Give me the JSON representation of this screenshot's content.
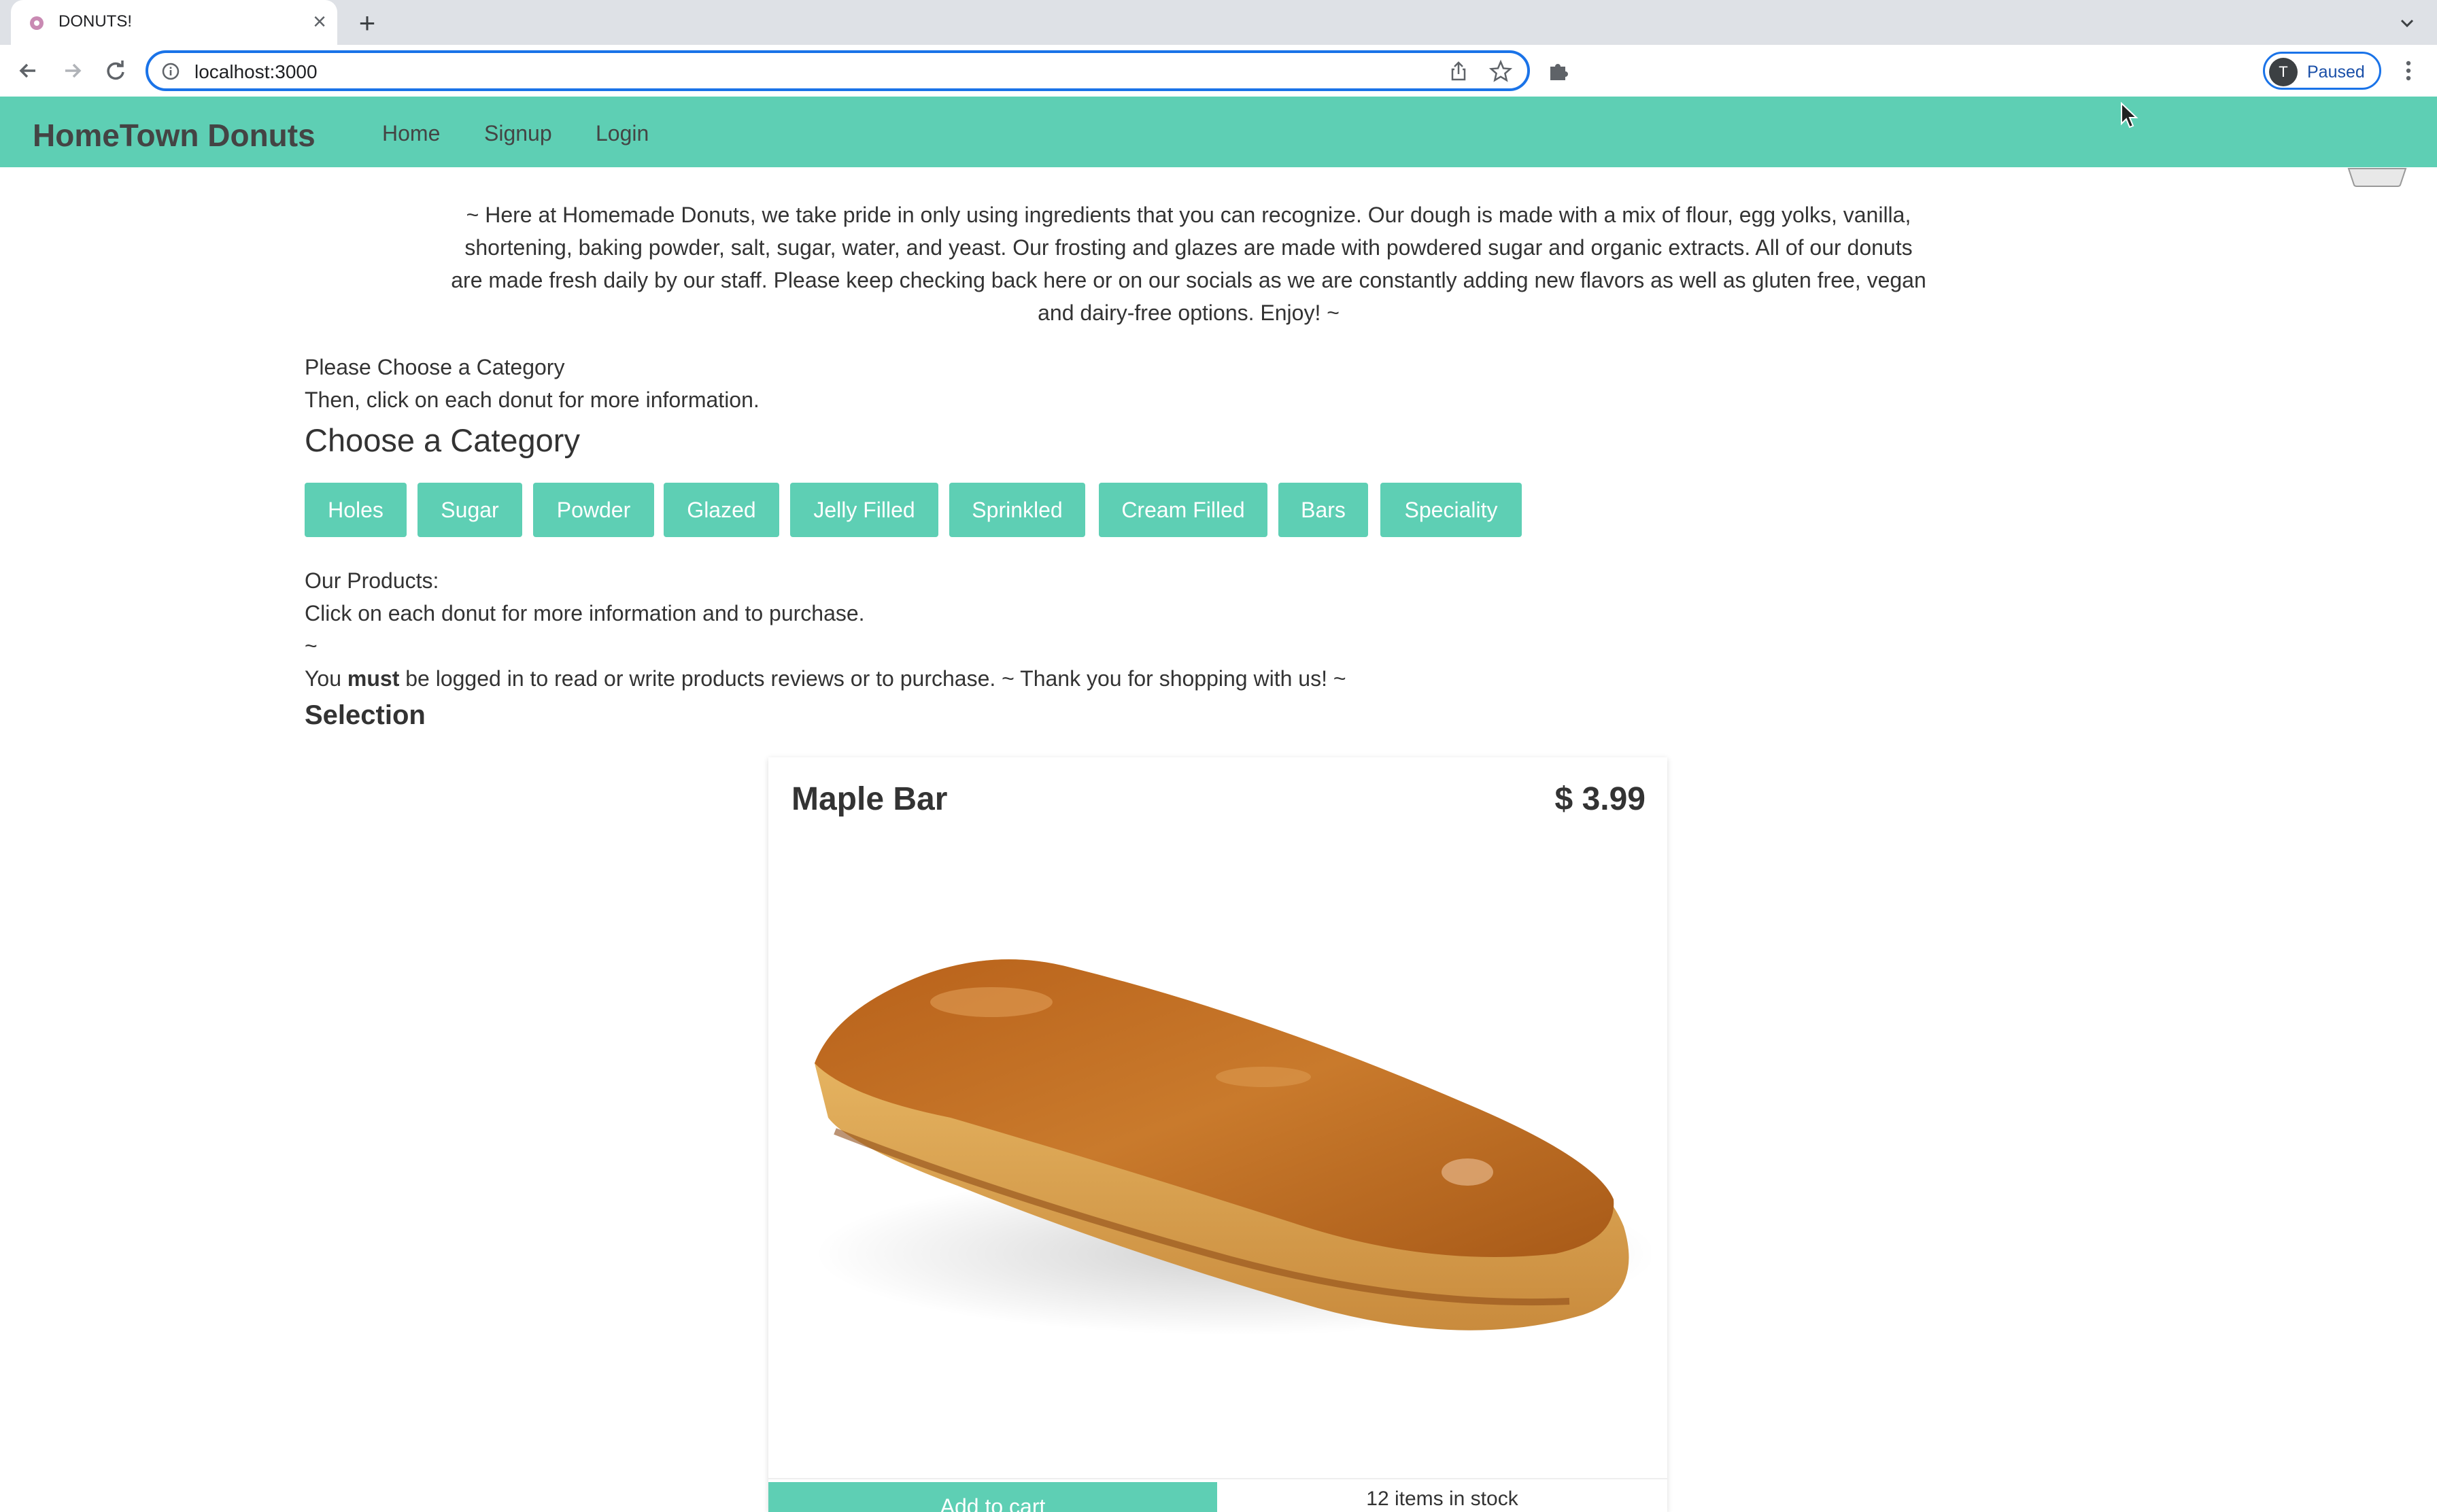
{
  "browser": {
    "tab_title": "DONUTS!",
    "url": "localhost:3000",
    "profile_initial": "T",
    "profile_status": "Paused"
  },
  "navbar": {
    "brand": "HomeTown Donuts",
    "links": [
      "Home",
      "Signup",
      "Login"
    ]
  },
  "intro": "~ Here at Homemade Donuts, we take pride in only using ingredients that you can recognize. Our dough is made with a mix of flour, egg yolks, vanilla, shortening, baking powder, salt, sugar, water, and yeast. Our frosting and glazes are made with powdered sugar and organic extracts. All of our donuts are made fresh daily by our staff. Please keep checking back here or on our socials as we are constantly adding new flavors as well as gluten free, vegan and dairy-free options. Enjoy! ~",
  "instructions": {
    "line1": "Please Choose a Category",
    "line2": "Then, click on each donut for more information."
  },
  "category_heading": "Choose a Category",
  "categories": [
    "Holes",
    "Sugar",
    "Powder",
    "Glazed",
    "Jelly Filled",
    "Sprinkled",
    "Cream Filled",
    "Bars",
    "Speciality"
  ],
  "products_info": {
    "line1": "Our Products:",
    "line2": "Click on each donut for more information and to purchase.",
    "line3": "~",
    "notice_before": "You ",
    "notice_bold": "must",
    "notice_after": " be logged in to read or write products reviews or to purchase. ~ Thank you for shopping with us! ~"
  },
  "selection_heading": "Selection",
  "product": {
    "name": "Maple Bar",
    "price": "$ 3.99",
    "add_to_cart": "Add to cart",
    "stock": "12 items in stock"
  },
  "colors": {
    "accent": "#5ecfb4",
    "browser_focus": "#1a73e8"
  },
  "icons": [
    "favicon-icon",
    "close-icon",
    "plus-icon",
    "chevron-down-icon",
    "back-arrow-icon",
    "forward-arrow-icon",
    "reload-icon",
    "info-icon",
    "share-icon",
    "star-icon",
    "puzzle-icon",
    "kebab-menu-icon",
    "cursor-icon",
    "basket-icon"
  ]
}
